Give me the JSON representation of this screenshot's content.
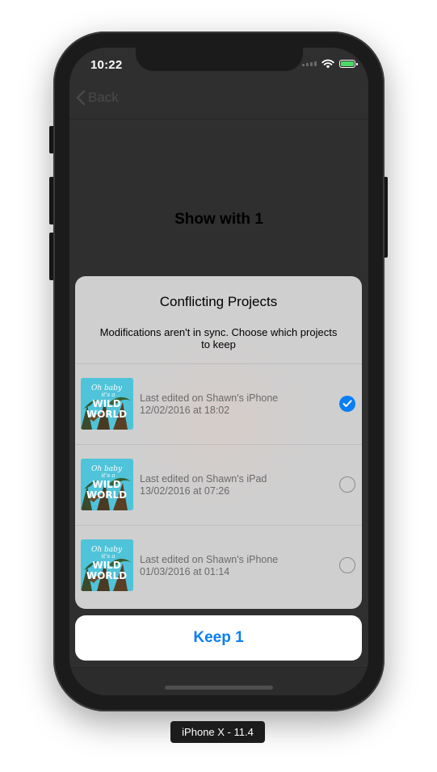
{
  "status_bar": {
    "time": "10:22",
    "icons": [
      "signal-dots-icon",
      "wifi-icon",
      "battery-charging-icon"
    ],
    "battery_color": "#4cd964"
  },
  "nav": {
    "back_label": "Back",
    "back_icon": "chevron-left-icon"
  },
  "page": {
    "heading": "Show with 1"
  },
  "sheet": {
    "title": "Conflicting Projects",
    "message": "Modifications aren't in sync. Choose which projects to keep",
    "background": "#cfcfcf",
    "projects": [
      {
        "thumbnail_text": "Oh baby it's a WILD WORLD",
        "device_line": "Last edited on Shawn's iPhone",
        "date_line": "12/02/2016 at 18:02",
        "selected": true
      },
      {
        "thumbnail_text": "Oh baby it's a WILD WORLD",
        "device_line": "Last edited on Shawn's iPad",
        "date_line": "13/02/2016 at 07:26",
        "selected": false
      },
      {
        "thumbnail_text": "Oh baby it's a WILD WORLD",
        "device_line": "Last edited on Shawn's iPhone",
        "date_line": "01/03/2016 at 01:14",
        "selected": false
      }
    ]
  },
  "actions": {
    "keep_label": "Keep 1",
    "accent_color": "#0a7ef5"
  },
  "device_label": "iPhone X - 11.4"
}
